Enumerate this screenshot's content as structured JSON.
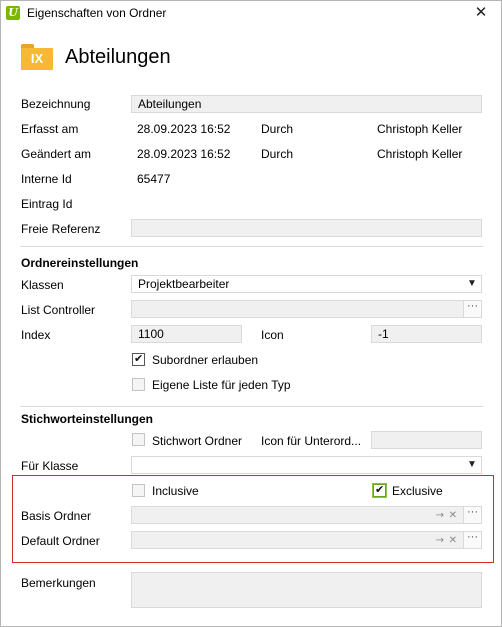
{
  "window": {
    "title": "Eigenschaften von Ordner",
    "close": "✕"
  },
  "folder_icon_text": "IX",
  "heading": "Abteilungen",
  "general": {
    "bezeichnung_label": "Bezeichnung",
    "bezeichnung_value": "Abteilungen",
    "erfasst_label": "Erfasst am",
    "erfasst_date": "28.09.2023 16:52",
    "erfasst_durch_label": "Durch",
    "erfasst_user": "Christoph Keller",
    "geaendert_label": "Geändert am",
    "geaendert_date": "28.09.2023 16:52",
    "geaendert_durch_label": "Durch",
    "geaendert_user": "Christoph Keller",
    "interne_id_label": "Interne Id",
    "interne_id_value": "65477",
    "eintrag_id_label": "Eintrag Id",
    "freie_referenz_label": "Freie Referenz",
    "freie_referenz_value": ""
  },
  "ordner": {
    "section_title": "Ordnereinstellungen",
    "klassen_label": "Klassen",
    "klassen_value": "Projektbearbeiter",
    "list_controller_label": "List Controller",
    "list_controller_value": "",
    "index_label": "Index",
    "index_value": "1100",
    "icon_label": "Icon",
    "icon_value": "-1",
    "subordner_label": "Subordner erlauben",
    "subordner_checked": true,
    "eigene_liste_label": "Eigene Liste für jeden Typ",
    "eigene_liste_checked": false
  },
  "stichwort": {
    "section_title": "Stichworteinstellungen",
    "stichwort_ordner_label": "Stichwort Ordner",
    "stichwort_ordner_checked": false,
    "icon_unterordner_label": "Icon für Unterord...",
    "icon_unterordner_value": "",
    "fuer_klasse_label": "Für Klasse",
    "fuer_klasse_value": "",
    "inclusive_label": "Inclusive",
    "inclusive_checked": false,
    "exclusive_label": "Exclusive",
    "exclusive_checked": true,
    "basis_ordner_label": "Basis Ordner",
    "basis_ordner_value": "",
    "default_ordner_label": "Default Ordner",
    "default_ordner_value": "",
    "bemerkungen_label": "Bemerkungen",
    "bemerkungen_value": ""
  },
  "icons": {
    "select_arrow": "▼",
    "ellipsis": "···",
    "navigate_arrow": "→",
    "clear_x": "✕"
  },
  "colors": {
    "highlight_border": "#d42a2a",
    "folder": "#f5b935",
    "app_icon": "#7ab800"
  }
}
